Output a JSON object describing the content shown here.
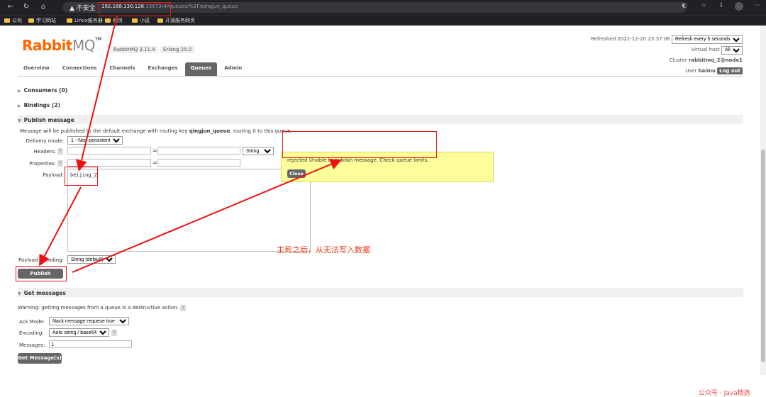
{
  "browser": {
    "security": "不安全",
    "url_host": "192.168.130.128",
    "url_rest": ":15673/#/queues/%2F/qingjun_queue",
    "bookmarks": [
      "公司",
      "学习网站",
      "Linux服务器",
      "网页",
      "小说",
      "开源服务网页"
    ]
  },
  "header": {
    "logo_main": "Rabbit",
    "logo_mq": "MQ",
    "logo_tm": "TM",
    "version": "RabbitMQ 3.11.4",
    "erlang": "Erlang 25.0",
    "refreshed": "Refreshed 2022-12-20 23:37:06",
    "refresh_option": "Refresh every 5 seconds",
    "vhost_label": "Virtual host",
    "vhost_value": "All",
    "cluster_label": "Cluster",
    "cluster_value": "rabbitmq_2@node1",
    "user_label": "User",
    "user_value": "baimu",
    "logout": "Log out"
  },
  "nav": [
    "Overview",
    "Connections",
    "Channels",
    "Exchanges",
    "Queues",
    "Admin"
  ],
  "sections": {
    "consumers": "Consumers (0)",
    "bindings": "Bindings (2)",
    "publish": "Publish message",
    "get": "Get messages"
  },
  "publish": {
    "info_pre": "Message will be published to the default exchange with routing key",
    "info_key": "qingjun_queue",
    "info_post": ", routing it to this queue.",
    "delivery_label": "Delivery mode:",
    "delivery_value": "1 - Non-persistent",
    "headers_label": "Headers:",
    "properties_label": "Properties:",
    "eq": "=",
    "type_value": "String",
    "payload_label": "Payload:",
    "payload_value": "beijing_2",
    "encoding_label": "Payload encoding:",
    "encoding_value": "String (default)",
    "button": "Publish message",
    "help": "?"
  },
  "error": {
    "message": "rejected Unable to publish message. Check queue limits.",
    "close": "Close"
  },
  "get": {
    "warning": "Warning: getting messages from a queue is a destructive action.",
    "ack_label": "Ack Mode:",
    "ack_value": "Nack message requeue true",
    "enc_label": "Encoding:",
    "enc_value": "Auto string / base64",
    "msgs_label": "Messages:",
    "msgs_value": "1",
    "button": "Get Message(s)"
  },
  "annotation": "主死之后，从无法写入数据",
  "watermark": "公众号 · Java精选",
  "colors": {
    "brand": "#ff6600",
    "annotation": "#e11111",
    "error_bg": "#fefe9a"
  }
}
